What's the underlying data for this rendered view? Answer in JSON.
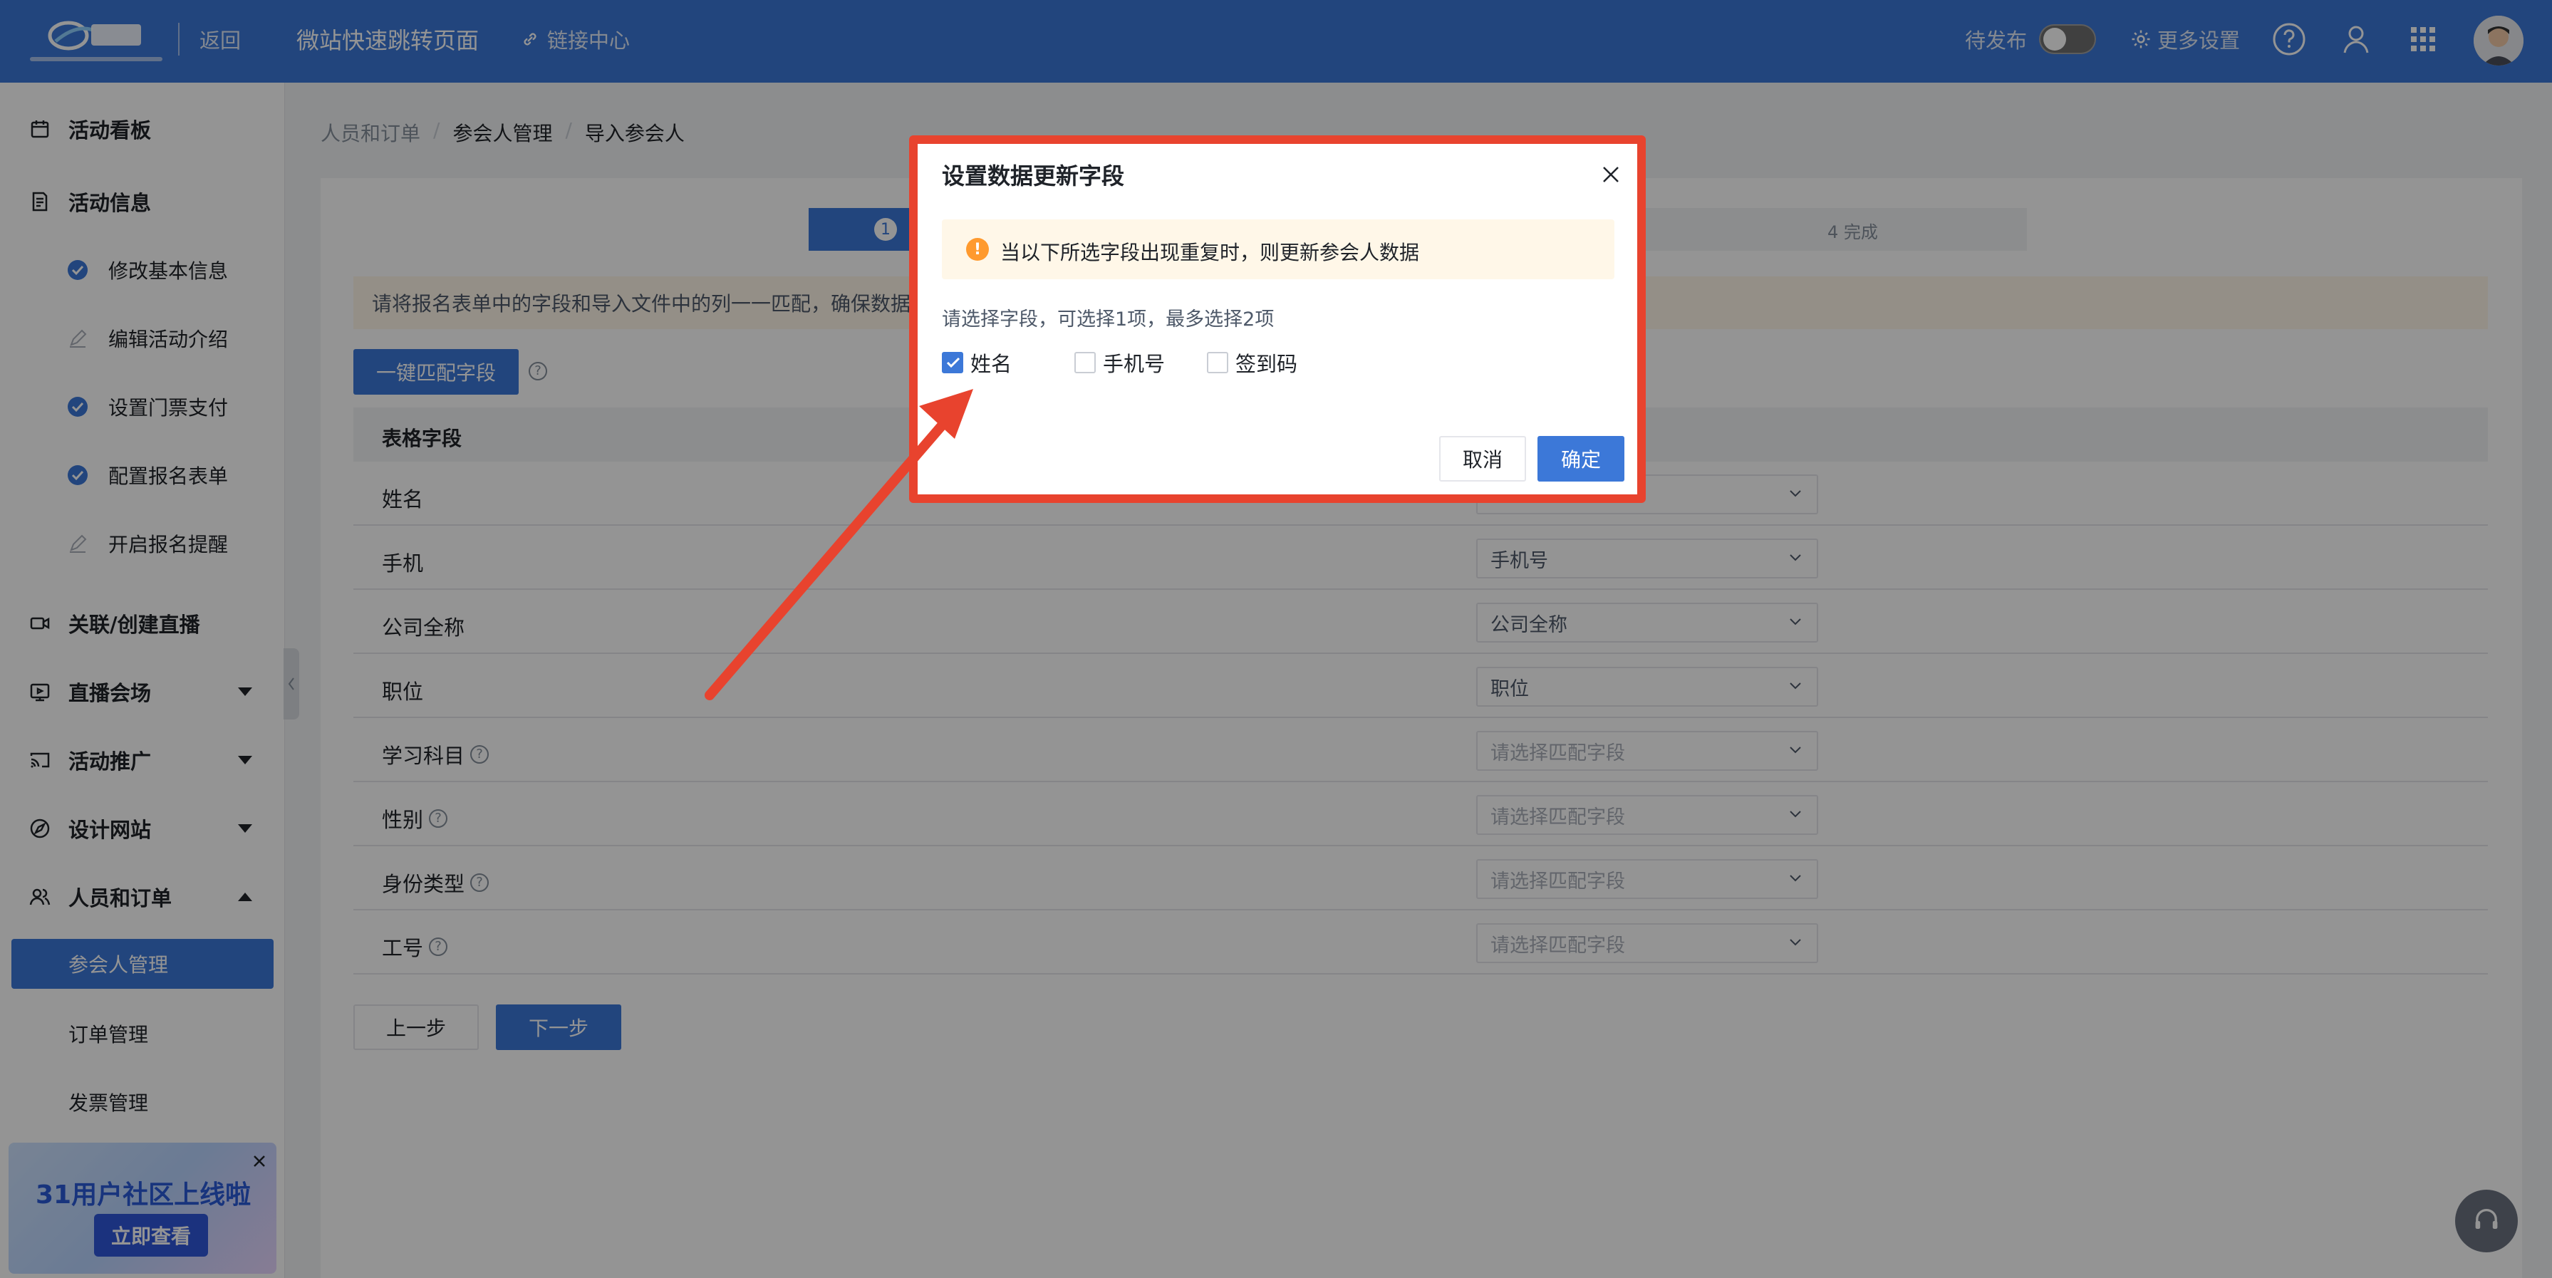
{
  "topbar": {
    "back_label": "返回",
    "page_title": "微站快速跳转页面",
    "link_center_label": "链接中心",
    "status_label": "待发布",
    "more_settings_label": "更多设置"
  },
  "sidebar": {
    "items": [
      {
        "label": "活动看板",
        "icon": "dashboard-icon"
      },
      {
        "label": "活动信息",
        "icon": "document-icon"
      },
      {
        "label": "关联/创建直播",
        "icon": "video-icon"
      },
      {
        "label": "直播会场",
        "icon": "broadcast-icon"
      },
      {
        "label": "活动推广",
        "icon": "cast-icon"
      },
      {
        "label": "设计网站",
        "icon": "compass-icon"
      },
      {
        "label": "人员和订单",
        "icon": "users-icon"
      }
    ],
    "subitems": [
      {
        "label": "修改基本信息",
        "state": "done"
      },
      {
        "label": "编辑活动介绍",
        "state": "todo"
      },
      {
        "label": "设置门票支付",
        "state": "done"
      },
      {
        "label": "配置报名表单",
        "state": "done"
      },
      {
        "label": "开启报名提醒",
        "state": "todo"
      }
    ],
    "leaves": [
      {
        "label": "参会人管理",
        "active": true
      },
      {
        "label": "订单管理",
        "active": false
      },
      {
        "label": "发票管理",
        "active": false
      }
    ],
    "promo": {
      "title": "31用户社区上线啦",
      "button": "立即查看"
    }
  },
  "breadcrumb": [
    "人员和订单",
    "参会人管理",
    "导入参会人"
  ],
  "steps": {
    "step1_num": "1",
    "step4_label": "4  完成"
  },
  "notice_text": "请将报名表单中的字段和导入文件中的列一一匹配，确保数据",
  "match_button": "一键匹配字段",
  "table": {
    "header": "表格字段",
    "rows": [
      {
        "name": "姓名",
        "value": "",
        "help": false,
        "placeholder": false
      },
      {
        "name": "手机",
        "value": "手机号",
        "help": false,
        "placeholder": false
      },
      {
        "name": "公司全称",
        "value": "公司全称",
        "help": false,
        "placeholder": false
      },
      {
        "name": "职位",
        "value": "职位",
        "help": false,
        "placeholder": false
      },
      {
        "name": "学习科目",
        "value": "请选择匹配字段",
        "help": true,
        "placeholder": true
      },
      {
        "name": "性别",
        "value": "请选择匹配字段",
        "help": true,
        "placeholder": true
      },
      {
        "name": "身份类型",
        "value": "请选择匹配字段",
        "help": true,
        "placeholder": true
      },
      {
        "name": "工号",
        "value": "请选择匹配字段",
        "help": true,
        "placeholder": true
      }
    ]
  },
  "buttons": {
    "prev": "上一步",
    "next": "下一步"
  },
  "dialog": {
    "title": "设置数据更新字段",
    "alert": "当以下所选字段出现重复时，则更新参会人数据",
    "hint": "请选择字段，可选择1项，最多选择2项",
    "options": [
      {
        "label": "姓名",
        "checked": true
      },
      {
        "label": "手机号",
        "checked": false
      },
      {
        "label": "签到码",
        "checked": false
      }
    ],
    "cancel": "取消",
    "ok": "确定"
  },
  "colors": {
    "primary": "#3c78d8",
    "highlight": "#e8432e",
    "warning": "#ff9a2e"
  }
}
